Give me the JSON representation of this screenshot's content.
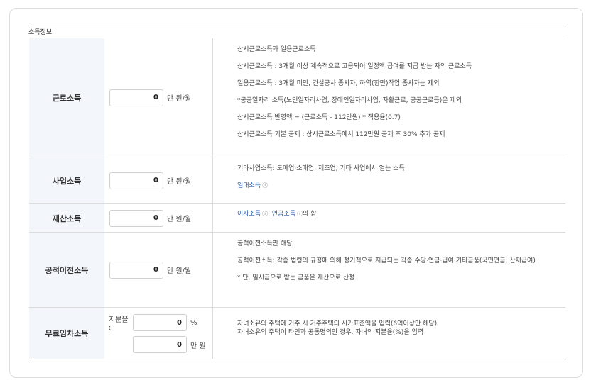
{
  "section_title": "소득정보",
  "rows": [
    {
      "label": "근로소득",
      "value": "0",
      "unit": "만 원/월",
      "desc": [
        "상시근로소득과 일용근로소득",
        "상시근로소득 : 3개월 이상 계속적으로 고용되어 일정액 급여를 지급 받는 자의 근로소득",
        "일용근로소득 : 3개월 미만, 건설공사 종사자, 하역(항만)작업 종사자는 제외",
        "*공공일자리 소득(노인일자리사업, 장애인일자리사업, 자활근로, 공공근로등)은 제외",
        "상시근로소득 반영액 = (근로소득 - 112만원) * 적용율(0.7)",
        "상시근로소득 기본 공제 : 상시근로소득에서 112만원 공제 후 30% 추가 공제"
      ]
    },
    {
      "label": "사업소득",
      "value": "0",
      "unit": "만 원/월",
      "desc": [
        "기타사업소득: 도매업·소매업, 제조업, 기타 사업에서 얻는 소득"
      ],
      "link": "임대소득"
    },
    {
      "label": "재산소득",
      "value": "0",
      "unit": "만 원/월",
      "link1": "이자소득",
      "sep": ", ",
      "link2": "연금소득",
      "suffix": "의 합"
    },
    {
      "label": "공적이전소득",
      "value": "0",
      "unit": "만 원/월",
      "desc": [
        "공적이전소득만 해당",
        "공적이전소득: 각종 법령의 규정에 의해 정기적으로 지급되는 각종 수당·연금·급여·기타금품(국민연금, 산재급여)",
        "* 단, 일시금으로 받는 금품은 재산으로 산정"
      ]
    },
    {
      "label": "무료임차소득",
      "share_label": "지분율 :",
      "share_value": "0",
      "share_unit": "%",
      "value": "0",
      "unit": "만 원",
      "desc": [
        "자녀소유의 주택에 거주 시 거주주택의 시가표준액을 입력(6억이상만 해당)",
        "자녀소유의 주택이 타인과 공동명의인 경우, 자녀의 지분율(%)을 입력"
      ]
    }
  ],
  "icons": {
    "info": "info-icon"
  }
}
